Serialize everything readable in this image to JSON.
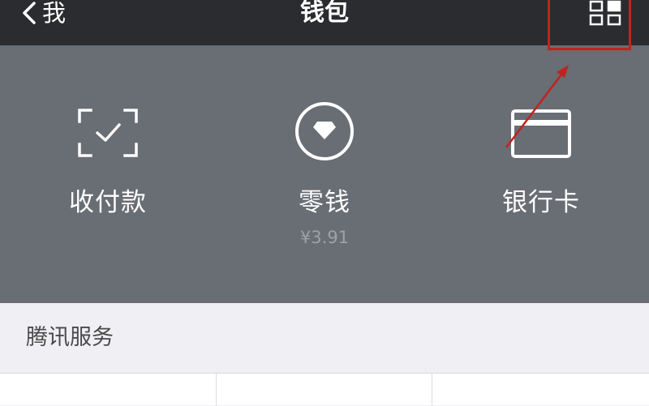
{
  "navbar": {
    "back_label": "我",
    "title": "钱包"
  },
  "hero": {
    "items": [
      {
        "label": "收付款",
        "icon": "scan-qr-icon"
      },
      {
        "label": "零钱",
        "sub": "¥3.91",
        "icon": "diamond-coin-icon"
      },
      {
        "label": "银行卡",
        "icon": "bank-card-icon"
      }
    ]
  },
  "services": {
    "title": "腾讯服务"
  },
  "colors": {
    "navbar_bg": "#2b2c2f",
    "hero_bg": "#696d74",
    "annotation": "#c0231e"
  }
}
